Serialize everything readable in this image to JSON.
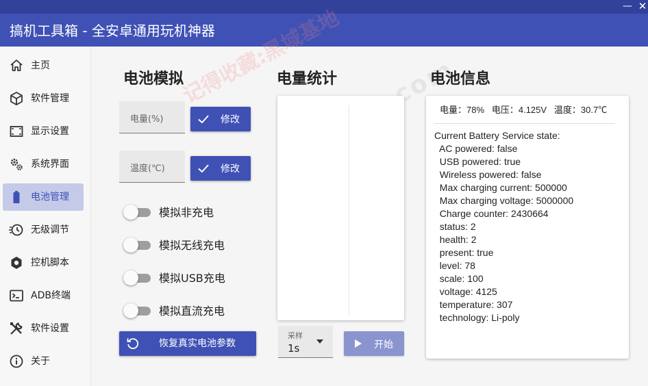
{
  "window": {
    "title": "搞机工具箱 - 全安卓通用玩机神器",
    "minimize_glyph": "—",
    "close_glyph": "✕"
  },
  "sidebar": {
    "items": [
      {
        "label": "主页",
        "icon": "home-icon"
      },
      {
        "label": "软件管理",
        "icon": "package-icon"
      },
      {
        "label": "显示设置",
        "icon": "display-icon"
      },
      {
        "label": "系统界面",
        "icon": "gears-icon"
      },
      {
        "label": "电池管理",
        "icon": "battery-icon",
        "active": true
      },
      {
        "label": "无级调节",
        "icon": "speed-icon"
      },
      {
        "label": "控机脚本",
        "icon": "hexagon-icon"
      },
      {
        "label": "ADB终端",
        "icon": "terminal-icon"
      },
      {
        "label": "软件设置",
        "icon": "tools-icon"
      },
      {
        "label": "关于",
        "icon": "info-icon"
      }
    ]
  },
  "battery_sim": {
    "title": "电池模拟",
    "level_placeholder": "电量(%)",
    "temp_placeholder": "温度(℃)",
    "modify_label": "修改",
    "toggles": [
      {
        "label": "模拟非充电",
        "on": false
      },
      {
        "label": "模拟无线充电",
        "on": false
      },
      {
        "label": "模拟USB充电",
        "on": false
      },
      {
        "label": "模拟直流充电",
        "on": false
      }
    ],
    "restore_label": "恢复真实电池参数"
  },
  "stats": {
    "title": "电量统计",
    "sample_caption": "采样",
    "sample_value": "1s",
    "start_label": "开始"
  },
  "info": {
    "title": "电池信息",
    "summary": "电量：78%   电压：4.125V   温度：30.7℃",
    "lines": [
      "Current Battery Service state:",
      "  AC powered: false",
      "  USB powered: true",
      "  Wireless powered: false",
      "  Max charging current: 500000",
      "  Max charging voltage: 5000000",
      "  Charge counter: 2430664",
      "  status: 2",
      "  health: 2",
      "  present: true",
      "  level: 78",
      "  scale: 100",
      "  voltage: 4125",
      "  temperature: 307",
      "  technology: Li-poly"
    ]
  },
  "watermark": {
    "text1": "记得收藏:黑域基地",
    "text2": "Hybase.com"
  },
  "colors": {
    "accent": "#3f51b5",
    "accent_dark": "#32429b",
    "active_nav": "#c5cae9"
  }
}
